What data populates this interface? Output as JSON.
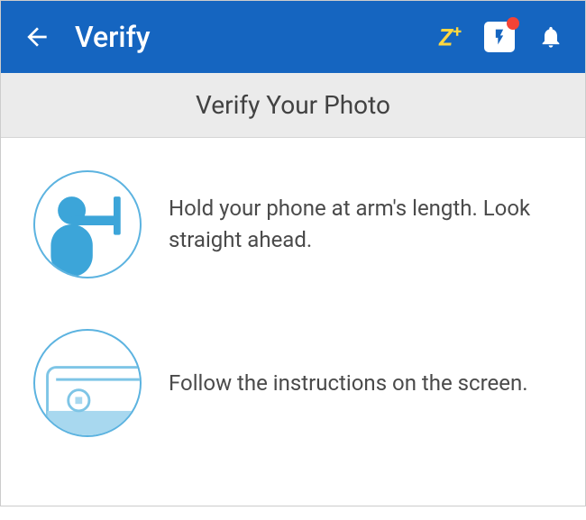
{
  "header": {
    "title": "Verify",
    "z_plus_label": "Z",
    "z_plus_suffix": "+"
  },
  "subheader": {
    "title": "Verify Your Photo"
  },
  "steps": [
    {
      "text": "Hold your phone at arm's length. Look straight ahead."
    },
    {
      "text": "Follow the instructions on the screen."
    }
  ]
}
